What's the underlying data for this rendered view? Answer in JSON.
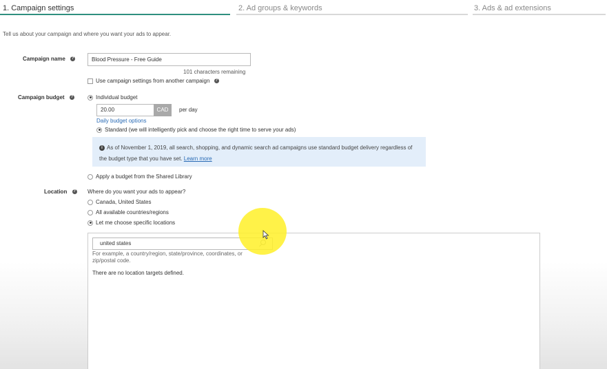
{
  "steps": [
    {
      "label": "1. Campaign settings",
      "active": true
    },
    {
      "label": "2. Ad groups & keywords",
      "active": false
    },
    {
      "label": "3. Ads & ad extensions",
      "active": false
    }
  ],
  "intro": "Tell us about your campaign and where you want your ads to appear.",
  "campaign_name": {
    "label": "Campaign name",
    "value": "Blood Pressure - Free Guide",
    "remaining": "101 characters remaining",
    "use_settings_label": "Use campaign settings from another campaign"
  },
  "budget": {
    "label": "Campaign budget",
    "individual_label": "Individual budget",
    "amount": "20.00",
    "currency": "CAD",
    "period": "per day",
    "daily_options_link": "Daily budget options",
    "standard_label": "Standard (we will intelligently pick and choose the right time to serve your ads)",
    "notice_text": "As of November 1, 2019, all search, shopping, and dynamic search ad campaigns use standard budget delivery regardless of the budget type that you have set.",
    "notice_link": "Learn more",
    "shared_label": "Apply a budget from the Shared Library"
  },
  "location": {
    "label": "Location",
    "question": "Where do you want your ads to appear?",
    "options": [
      {
        "label": "Canada, United States",
        "selected": false
      },
      {
        "label": "All available countries/regions",
        "selected": false
      },
      {
        "label": "Let me choose specific locations",
        "selected": true
      }
    ],
    "search_value": "united states",
    "hint_line1": "For example, a country/region, state/province, coordinates, or",
    "hint_line2": "zip/postal code.",
    "empty_text": "There are no location targets defined."
  },
  "colors": {
    "accent": "#2f8f7e",
    "link": "#2a6bb5",
    "notice_bg": "#e3eefa",
    "highlight": "#fff028"
  }
}
